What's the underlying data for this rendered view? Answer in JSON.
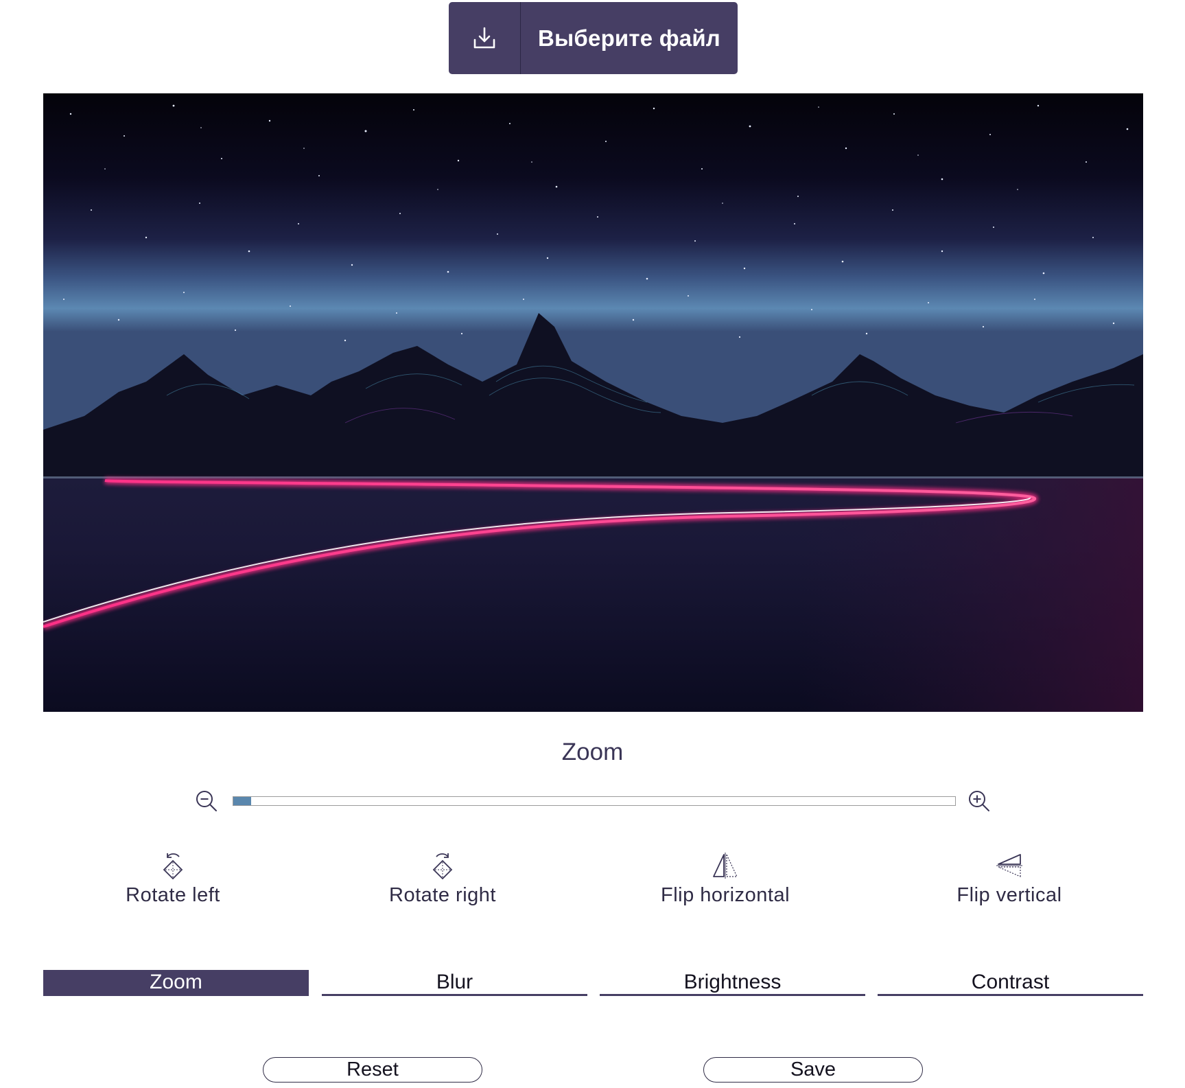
{
  "upload": {
    "label": "Выберите файл",
    "icon": "download-icon"
  },
  "preview": {
    "icon": "night-mountains-image"
  },
  "zoom": {
    "title": "Zoom",
    "level": 0.025,
    "out_icon": "zoom-out-icon",
    "in_icon": "zoom-in-icon",
    "fill_color": "#5a87ad"
  },
  "tools": [
    {
      "label": "Rotate left",
      "icon": "rotate-left-icon"
    },
    {
      "label": "Rotate right",
      "icon": "rotate-right-icon"
    },
    {
      "label": "Flip horizontal",
      "icon": "flip-horizontal-icon"
    },
    {
      "label": "Flip vertical",
      "icon": "flip-vertical-icon"
    }
  ],
  "tabs": [
    {
      "label": "Zoom",
      "active": true
    },
    {
      "label": "Blur",
      "active": false
    },
    {
      "label": "Brightness",
      "active": false
    },
    {
      "label": "Contrast",
      "active": false
    }
  ],
  "actions": {
    "reset": "Reset",
    "save": "Save"
  },
  "colors": {
    "accent": "#463e64",
    "text": "#2f2b45"
  }
}
